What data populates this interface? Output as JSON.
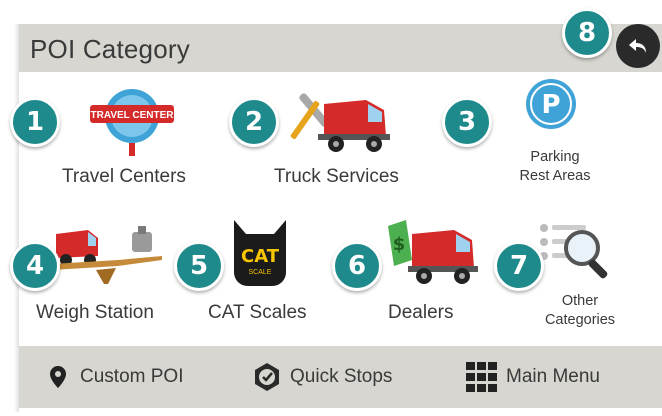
{
  "header": {
    "title": "POI Category",
    "back_label": "8"
  },
  "categories": [
    {
      "number": "1",
      "label": "Travel Centers",
      "sign_text": "TRAVEL CENTER"
    },
    {
      "number": "2",
      "label": "Truck Services"
    },
    {
      "number": "3",
      "label_line1": "Parking",
      "label_line2": "Rest Areas",
      "icon_letter": "P"
    },
    {
      "number": "4",
      "label": "Weigh Station"
    },
    {
      "number": "5",
      "label": "CAT Scales",
      "logo_text": "CAT",
      "logo_sub": "SCALE"
    },
    {
      "number": "6",
      "label": "Dealers",
      "tag_text": "$"
    },
    {
      "number": "7",
      "label_line1": "Other",
      "label_line2": "Categories"
    }
  ],
  "footer": {
    "custom_poi": "Custom POI",
    "quick_stops": "Quick Stops",
    "main_menu": "Main Menu"
  },
  "colors": {
    "accent": "#1f8a8c",
    "bar": "#d7d6d0",
    "truck_red": "#d42a2a"
  }
}
